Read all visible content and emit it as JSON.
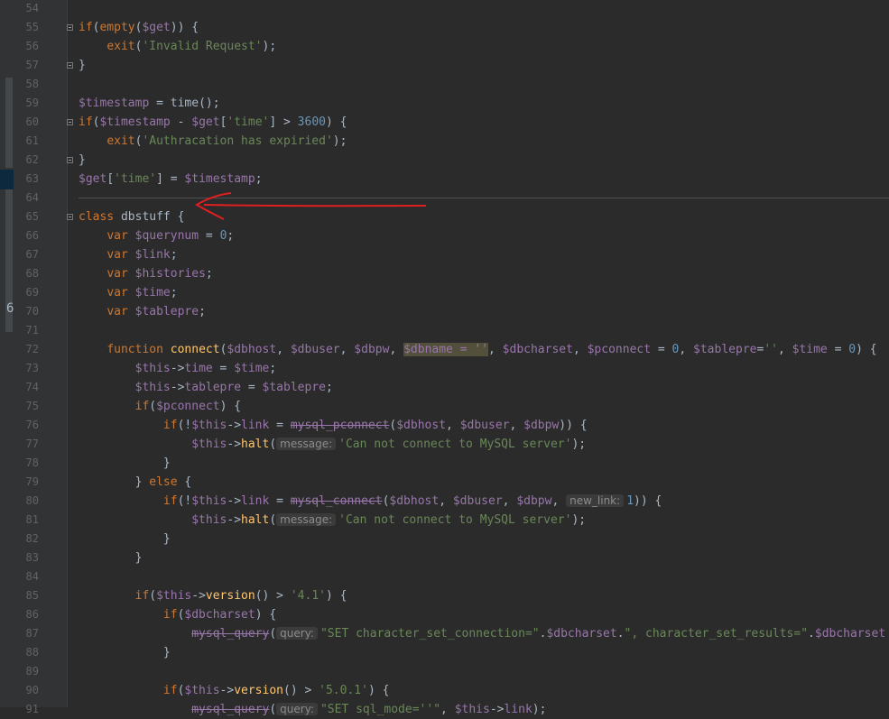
{
  "editor": {
    "left_strip_number": "6",
    "lines": [
      {
        "n": "54",
        "tokens": []
      },
      {
        "n": "55",
        "tokens": [
          [
            "kw",
            "if"
          ],
          [
            "p",
            "("
          ],
          [
            "kw",
            "empty"
          ],
          [
            "p",
            "("
          ],
          [
            "var",
            "$get"
          ],
          [
            "p",
            ")) {"
          ]
        ]
      },
      {
        "n": "56",
        "tokens": [
          [
            "p",
            "    "
          ],
          [
            "kw",
            "exit"
          ],
          [
            "p",
            "("
          ],
          [
            "str",
            "'Invalid Request'"
          ],
          [
            "p",
            ");"
          ]
        ]
      },
      {
        "n": "57",
        "tokens": [
          [
            "p",
            "}"
          ]
        ]
      },
      {
        "n": "58",
        "tokens": []
      },
      {
        "n": "59",
        "tokens": [
          [
            "var",
            "$timestamp"
          ],
          [
            "p",
            " = time();"
          ]
        ]
      },
      {
        "n": "60",
        "tokens": [
          [
            "kw",
            "if"
          ],
          [
            "p",
            "("
          ],
          [
            "var",
            "$timestamp"
          ],
          [
            "p",
            " - "
          ],
          [
            "var",
            "$get"
          ],
          [
            "p",
            "["
          ],
          [
            "str",
            "'time'"
          ],
          [
            "p",
            "] > "
          ],
          [
            "num",
            "3600"
          ],
          [
            "p",
            ") {"
          ]
        ]
      },
      {
        "n": "61",
        "tokens": [
          [
            "p",
            "    "
          ],
          [
            "kw",
            "exit"
          ],
          [
            "p",
            "("
          ],
          [
            "str",
            "'Authracation has expiried'"
          ],
          [
            "p",
            ");"
          ]
        ]
      },
      {
        "n": "62",
        "tokens": [
          [
            "p",
            "}"
          ]
        ]
      },
      {
        "n": "63",
        "tokens": [
          [
            "var",
            "$get"
          ],
          [
            "p",
            "["
          ],
          [
            "str",
            "'time'"
          ],
          [
            "p",
            "] = "
          ],
          [
            "var",
            "$timestamp"
          ],
          [
            "p",
            ";"
          ]
        ]
      },
      {
        "n": "64",
        "tokens": []
      },
      {
        "n": "65",
        "tokens": [
          [
            "kw",
            "class"
          ],
          [
            "p",
            " dbstuff {"
          ]
        ]
      },
      {
        "n": "66",
        "tokens": [
          [
            "p",
            "    "
          ],
          [
            "kw",
            "var"
          ],
          [
            "p",
            " "
          ],
          [
            "var",
            "$querynum"
          ],
          [
            "p",
            " = "
          ],
          [
            "num",
            "0"
          ],
          [
            "p",
            ";"
          ]
        ]
      },
      {
        "n": "67",
        "tokens": [
          [
            "p",
            "    "
          ],
          [
            "kw",
            "var"
          ],
          [
            "p",
            " "
          ],
          [
            "var",
            "$link"
          ],
          [
            "p",
            ";"
          ]
        ]
      },
      {
        "n": "68",
        "tokens": [
          [
            "p",
            "    "
          ],
          [
            "kw",
            "var"
          ],
          [
            "p",
            " "
          ],
          [
            "var",
            "$histories"
          ],
          [
            "p",
            ";"
          ]
        ]
      },
      {
        "n": "69",
        "tokens": [
          [
            "p",
            "    "
          ],
          [
            "kw",
            "var"
          ],
          [
            "p",
            " "
          ],
          [
            "var",
            "$time"
          ],
          [
            "p",
            ";"
          ]
        ]
      },
      {
        "n": "70",
        "tokens": [
          [
            "p",
            "    "
          ],
          [
            "kw",
            "var"
          ],
          [
            "p",
            " "
          ],
          [
            "var",
            "$tablepre"
          ],
          [
            "p",
            ";"
          ]
        ]
      },
      {
        "n": "71",
        "tokens": []
      },
      {
        "n": "72",
        "tokens": [
          [
            "p",
            "    "
          ],
          [
            "kw",
            "function"
          ],
          [
            "p",
            " "
          ],
          [
            "fn",
            "connect"
          ],
          [
            "p",
            "("
          ],
          [
            "var",
            "$dbhost"
          ],
          [
            "p",
            ", "
          ],
          [
            "var",
            "$dbuser"
          ],
          [
            "p",
            ", "
          ],
          [
            "var",
            "$dbpw"
          ],
          [
            "p",
            ", "
          ],
          [
            "hl",
            "$dbname = ''"
          ],
          [
            "p",
            ", "
          ],
          [
            "var",
            "$dbcharset"
          ],
          [
            "p",
            ", "
          ],
          [
            "var",
            "$pconnect"
          ],
          [
            "p",
            " = "
          ],
          [
            "num",
            "0"
          ],
          [
            "p",
            ", "
          ],
          [
            "var",
            "$tablepre"
          ],
          [
            "p",
            "="
          ],
          [
            "str",
            "''"
          ],
          [
            "p",
            ", "
          ],
          [
            "var",
            "$time"
          ],
          [
            "p",
            " = "
          ],
          [
            "num",
            "0"
          ],
          [
            "p",
            ") {"
          ]
        ]
      },
      {
        "n": "73",
        "tokens": [
          [
            "p",
            "        "
          ],
          [
            "var",
            "$this"
          ],
          [
            "p",
            "->"
          ],
          [
            "var",
            "time"
          ],
          [
            "p",
            " = "
          ],
          [
            "var",
            "$time"
          ],
          [
            "p",
            ";"
          ]
        ]
      },
      {
        "n": "74",
        "tokens": [
          [
            "p",
            "        "
          ],
          [
            "var",
            "$this"
          ],
          [
            "p",
            "->"
          ],
          [
            "var",
            "tablepre"
          ],
          [
            "p",
            " = "
          ],
          [
            "var",
            "$tablepre"
          ],
          [
            "p",
            ";"
          ]
        ]
      },
      {
        "n": "75",
        "tokens": [
          [
            "p",
            "        "
          ],
          [
            "kw",
            "if"
          ],
          [
            "p",
            "("
          ],
          [
            "var",
            "$pconnect"
          ],
          [
            "p",
            ") {"
          ]
        ]
      },
      {
        "n": "76",
        "tokens": [
          [
            "p",
            "            "
          ],
          [
            "kw",
            "if"
          ],
          [
            "p",
            "(!"
          ],
          [
            "var",
            "$this"
          ],
          [
            "p",
            "->"
          ],
          [
            "var",
            "link"
          ],
          [
            "p",
            " = "
          ],
          [
            "strike",
            "mysql_pconnect"
          ],
          [
            "p",
            "("
          ],
          [
            "var",
            "$dbhost"
          ],
          [
            "p",
            ", "
          ],
          [
            "var",
            "$dbuser"
          ],
          [
            "p",
            ", "
          ],
          [
            "var",
            "$dbpw"
          ],
          [
            "p",
            ")) {"
          ]
        ]
      },
      {
        "n": "77",
        "tokens": [
          [
            "p",
            "                "
          ],
          [
            "var",
            "$this"
          ],
          [
            "p",
            "->"
          ],
          [
            "fn",
            "halt"
          ],
          [
            "p",
            "("
          ],
          [
            "hint",
            "message:"
          ],
          [
            "str",
            "'Can not connect to MySQL server'"
          ],
          [
            "p",
            ");"
          ]
        ]
      },
      {
        "n": "78",
        "tokens": [
          [
            "p",
            "            }"
          ]
        ]
      },
      {
        "n": "79",
        "tokens": [
          [
            "p",
            "        } "
          ],
          [
            "kw",
            "else"
          ],
          [
            "p",
            " {"
          ]
        ]
      },
      {
        "n": "80",
        "tokens": [
          [
            "p",
            "            "
          ],
          [
            "kw",
            "if"
          ],
          [
            "p",
            "(!"
          ],
          [
            "var",
            "$this"
          ],
          [
            "p",
            "->"
          ],
          [
            "var",
            "link"
          ],
          [
            "p",
            " = "
          ],
          [
            "strike",
            "mysql_connect"
          ],
          [
            "p",
            "("
          ],
          [
            "var",
            "$dbhost"
          ],
          [
            "p",
            ", "
          ],
          [
            "var",
            "$dbuser"
          ],
          [
            "p",
            ", "
          ],
          [
            "var",
            "$dbpw"
          ],
          [
            "p",
            ", "
          ],
          [
            "hint",
            "new_link:"
          ],
          [
            "num",
            "1"
          ],
          [
            "p",
            ")) {"
          ]
        ]
      },
      {
        "n": "81",
        "tokens": [
          [
            "p",
            "                "
          ],
          [
            "var",
            "$this"
          ],
          [
            "p",
            "->"
          ],
          [
            "fn",
            "halt"
          ],
          [
            "p",
            "("
          ],
          [
            "hint",
            "message:"
          ],
          [
            "str",
            "'Can not connect to MySQL server'"
          ],
          [
            "p",
            ");"
          ]
        ]
      },
      {
        "n": "82",
        "tokens": [
          [
            "p",
            "            }"
          ]
        ]
      },
      {
        "n": "83",
        "tokens": [
          [
            "p",
            "        }"
          ]
        ]
      },
      {
        "n": "84",
        "tokens": []
      },
      {
        "n": "85",
        "tokens": [
          [
            "p",
            "        "
          ],
          [
            "kw",
            "if"
          ],
          [
            "p",
            "("
          ],
          [
            "var",
            "$this"
          ],
          [
            "p",
            "->"
          ],
          [
            "fn",
            "version"
          ],
          [
            "p",
            "() > "
          ],
          [
            "str",
            "'4.1'"
          ],
          [
            "p",
            ") {"
          ]
        ]
      },
      {
        "n": "86",
        "tokens": [
          [
            "p",
            "            "
          ],
          [
            "kw",
            "if"
          ],
          [
            "p",
            "("
          ],
          [
            "var",
            "$dbcharset"
          ],
          [
            "p",
            ") {"
          ]
        ]
      },
      {
        "n": "87",
        "tokens": [
          [
            "p",
            "                "
          ],
          [
            "strike",
            "mysql_query"
          ],
          [
            "p",
            "("
          ],
          [
            "hint",
            "query:"
          ],
          [
            "str",
            "\"SET character_set_connection=\""
          ],
          [
            "p",
            "."
          ],
          [
            "var",
            "$dbcharset"
          ],
          [
            "p",
            "."
          ],
          [
            "str",
            "\", character_set_results=\""
          ],
          [
            "p",
            "."
          ],
          [
            "var",
            "$dbcharset"
          ]
        ]
      },
      {
        "n": "88",
        "tokens": [
          [
            "p",
            "            }"
          ]
        ]
      },
      {
        "n": "89",
        "tokens": []
      },
      {
        "n": "90",
        "tokens": [
          [
            "p",
            "            "
          ],
          [
            "kw",
            "if"
          ],
          [
            "p",
            "("
          ],
          [
            "var",
            "$this"
          ],
          [
            "p",
            "->"
          ],
          [
            "fn",
            "version"
          ],
          [
            "p",
            "() > "
          ],
          [
            "str",
            "'5.0.1'"
          ],
          [
            "p",
            ") {"
          ]
        ]
      },
      {
        "n": "91",
        "tokens": [
          [
            "p",
            "                "
          ],
          [
            "strike",
            "mysql_query"
          ],
          [
            "p",
            "("
          ],
          [
            "hint",
            "query:"
          ],
          [
            "str",
            "\"SET sql_mode=''\""
          ],
          [
            "p",
            ", "
          ],
          [
            "var",
            "$this"
          ],
          [
            "p",
            "->"
          ],
          [
            "var",
            "link"
          ],
          [
            "p",
            ");"
          ]
        ]
      }
    ]
  },
  "colors": {
    "background": "#2b2b2b",
    "keyword": "#cc7832",
    "variable": "#9876aa",
    "string": "#6a8759",
    "number": "#6897bb",
    "function": "#ffc66d",
    "annotation_arrow": "#e02020"
  }
}
